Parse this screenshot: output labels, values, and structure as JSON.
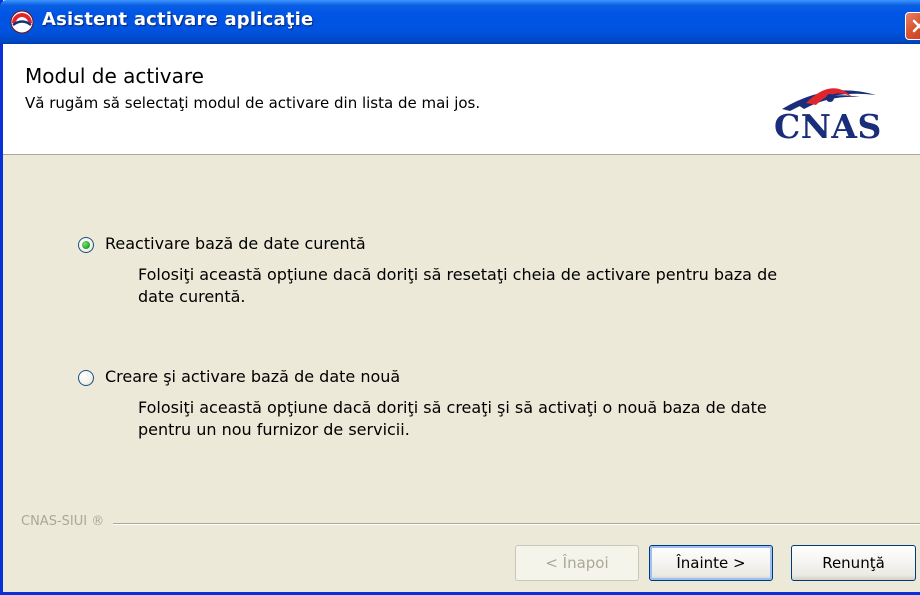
{
  "window": {
    "title": "Asistent activare aplicaţie"
  },
  "header": {
    "title": "Modul de activare",
    "subtitle": "Vă rugăm să selectaţi modul de activare din lista de mai jos.",
    "logo_text": "CNAS"
  },
  "options": [
    {
      "label": "Reactivare bază de date curentă",
      "description": "Folosiţi această opţiune dacă doriţi să resetaţi cheia de activare pentru baza de date curentă.",
      "selected": true
    },
    {
      "label": "Creare şi activare bază de date nouă",
      "description": "Folosiţi această opţiune dacă doriţi să creaţi şi să activaţi o nouă baza de date pentru un nou furnizor de servicii.",
      "selected": false
    }
  ],
  "footer": {
    "brand": "CNAS-SIUI ®"
  },
  "buttons": {
    "back": "< Înapoi",
    "next": "Înainte >",
    "cancel": "Renunţă"
  },
  "colors": {
    "titlebar": "#0055E5",
    "dialog_bg": "#ECE9D8",
    "logo_blue": "#1A2D7A",
    "logo_red": "#E0262C"
  }
}
